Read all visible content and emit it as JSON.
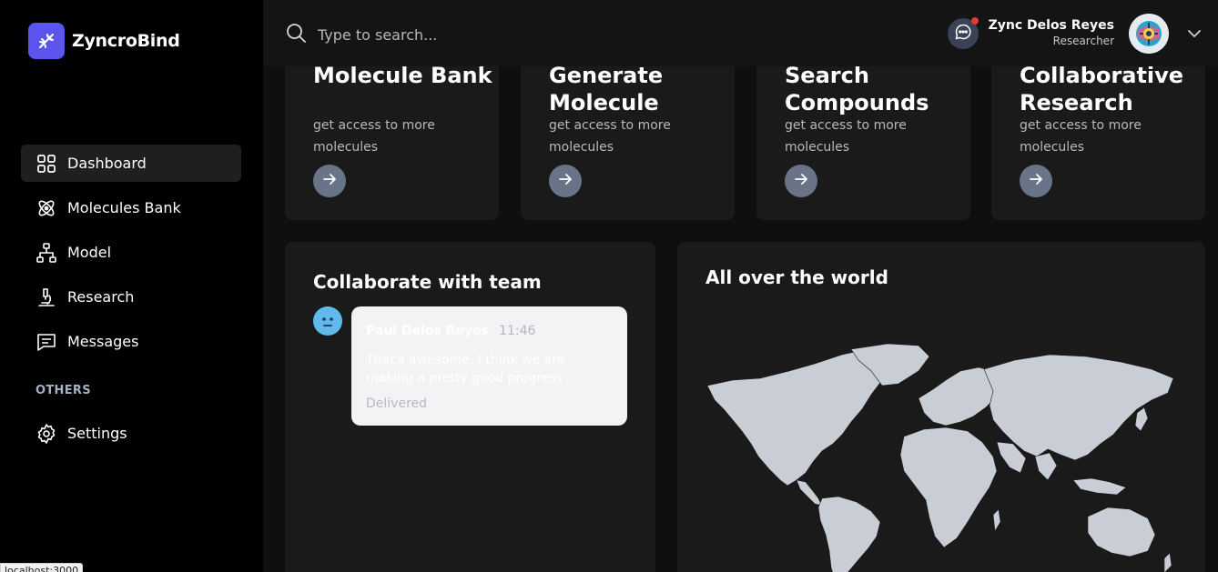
{
  "brand": {
    "name": "ZyncroBind",
    "logo_icon": "dna-icon"
  },
  "sidebar": {
    "items": [
      {
        "label": "Dashboard",
        "icon": "grid-icon",
        "active": true
      },
      {
        "label": "Molecules Bank",
        "icon": "atom-icon"
      },
      {
        "label": "Model",
        "icon": "hierarchy-icon"
      },
      {
        "label": "Research",
        "icon": "microscope-icon"
      },
      {
        "label": "Messages",
        "icon": "chat-icon"
      }
    ],
    "section_label": "OTHERS",
    "settings": {
      "label": "Settings",
      "icon": "gear-icon"
    }
  },
  "status_bar": {
    "url": "localhost:3000"
  },
  "header": {
    "search": {
      "placeholder": "Type to search...",
      "value": ""
    },
    "user": {
      "name": "Zync Delos Reyes",
      "role": "Researcher"
    }
  },
  "cards": [
    {
      "title": "Molecule Bank",
      "description": "get access to more molecules"
    },
    {
      "title": "Generate Molecule",
      "description": "get access to more molecules"
    },
    {
      "title": "Search Compounds",
      "description": "get access to more molecules"
    },
    {
      "title": "Collaborative Research",
      "description": "get access to more molecules"
    }
  ],
  "collaborate": {
    "title": "Collaborate with team",
    "message": {
      "sender": "Paul Delos Reyes",
      "time": "11:46",
      "text": "That's awesome. I think we are making a pretty good progress",
      "status": "Delivered"
    }
  },
  "world": {
    "title": "All over the world"
  },
  "colors": {
    "accent": "#5b55f0",
    "sidebar_bg": "#000000",
    "card_bg": "#1a1a1b",
    "card_button": "#6a7488",
    "notification": "#e53935",
    "map_land": "#c9ced6"
  }
}
